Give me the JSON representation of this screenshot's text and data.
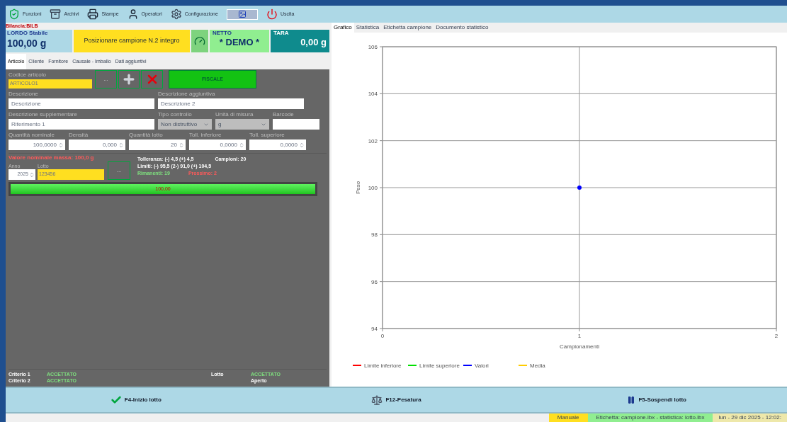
{
  "toolbar": [
    {
      "label": "Funzioni",
      "kind": "shield"
    },
    {
      "label": "Archivi",
      "kind": "archive"
    },
    {
      "label": "Stampe",
      "kind": "printer"
    },
    {
      "label": "Operatori",
      "kind": "user"
    },
    {
      "label": "Configurazione",
      "kind": "gear"
    },
    {
      "kind": "image"
    },
    {
      "label": "Uscita",
      "kind": "power"
    }
  ],
  "scale_name": "Bilancia:BILB",
  "weights": {
    "gross_label": "LORDO Stabile",
    "gross": "100,00 g",
    "message": "Posizionare campione N.2 integro",
    "net_label": "NETTO",
    "net": "* DEMO *",
    "tare_label": "TARA",
    "tare": "0,00 g"
  },
  "tabs": [
    {
      "label": "Articolo",
      "selected": true
    },
    {
      "label": "Cliente",
      "selected": false
    },
    {
      "label": "Fornitore",
      "selected": false
    },
    {
      "label": "Causale - Imballo",
      "selected": false
    },
    {
      "label": "Dati aggiuntivi",
      "selected": false
    }
  ],
  "article": {
    "label": "Codice articolo",
    "value": "ARTICOLO1",
    "buttons": [
      "..."
    ],
    "fiscal": "FISCALE"
  },
  "rows": [
    [
      {
        "label": "Descrizione",
        "value": "Descrizione",
        "kind": "text",
        "disabled": false
      },
      {
        "label": "Descrizione aggiuntiva",
        "value": "Descrizione 2",
        "kind": "text",
        "disabled": false
      }
    ],
    [
      {
        "label": "Descrizione supplementare",
        "value": "Riferimento 1",
        "kind": "text",
        "disabled": false
      },
      {
        "label": "Tipo controllo",
        "value": "Non distruttivo",
        "kind": "select",
        "disabled": true
      },
      {
        "label": "Unità di misura",
        "value": "g",
        "kind": "select",
        "disabled": true
      },
      {
        "label": "Barcode",
        "kind": "short_text",
        "disabled": false
      }
    ],
    [
      {
        "label": "Quantità nominale",
        "value": "100,0000",
        "kind": "spin",
        "disabled": false
      },
      {
        "label": "Densità",
        "value": "0,000",
        "kind": "spin",
        "disabled": false
      },
      {
        "label": "Quantità lotto",
        "value": "20",
        "kind": "spin",
        "disabled": false
      },
      {
        "label": "Toll. inferiore",
        "value": "0,0000",
        "kind": "spin",
        "disabled": false
      },
      {
        "label": "Toll. superiore",
        "value": "0,0000",
        "kind": "spin",
        "disabled": false
      }
    ]
  ],
  "lot": {
    "nominal": "Valore nominale massa: 100,0 g",
    "year_label": "Anno",
    "year": "2025",
    "lot_label": "Lotto",
    "lot": "123456",
    "button": "...",
    "tolerance": "Tolleranza: (-) 4,5 (+) 4,5",
    "limits": "Limiti: (-) 95,5 (2-) 91,0 (+) 104,5",
    "remaining": "Rimanenti: 19",
    "next": "Prossimo: 2",
    "samples": "Campioni: 20"
  },
  "progress": {
    "level": 1,
    "reading": "100,00"
  },
  "criteria": [
    {
      "label": "Criterio 1",
      "value": "ACCETTATO",
      "accepted": true
    },
    {
      "label": "Criterio 2",
      "value": "ACCETTATO",
      "accepted": true
    }
  ],
  "lot_status": {
    "label": "Lotto",
    "value": "ACCETTATO",
    "state": "Aperto"
  },
  "right_tabs": [
    {
      "label": "Grafico",
      "selected": true
    },
    {
      "label": "Statistica",
      "selected": false
    },
    {
      "label": "Etichetta campione",
      "selected": false
    },
    {
      "label": "Documento statistico",
      "selected": false
    }
  ],
  "chart_data": {
    "type": "line",
    "grid": true,
    "xlabel": "Campionamenti",
    "ylabel": "Peso",
    "x": [
      1
    ],
    "xlim": [
      0,
      2
    ],
    "ylim": [
      94,
      106
    ],
    "xticks": [
      0,
      1,
      2
    ],
    "yticks": [
      94,
      96,
      98,
      100,
      102,
      104,
      106
    ],
    "series": [
      {
        "name": "Limite inferiore",
        "color": "#ff0000",
        "values": [
          null
        ]
      },
      {
        "name": "Limite superiore",
        "color": "#00e000",
        "values": [
          null
        ]
      },
      {
        "name": "Valori",
        "color": "#0000ff",
        "marker": "circle",
        "values": [
          100
        ]
      },
      {
        "name": "Media",
        "color": "#ffcc00",
        "values": [
          null
        ]
      }
    ]
  },
  "actions": [
    {
      "label": "F4-Inizio lotto",
      "kind": "check"
    },
    {
      "label": "F12-Pesatura",
      "kind": "scale"
    },
    {
      "label": "F5-Sospendi lotto",
      "kind": "pause"
    }
  ],
  "status_bar": [
    {
      "text": "Manuale",
      "kind": "mode"
    },
    {
      "text": "Etichetta: campione.lbx - statistica: lotto.lbx",
      "kind": "labels"
    },
    {
      "text": "lun - 29 dic 2025 - 12:02:",
      "kind": "clock"
    }
  ]
}
